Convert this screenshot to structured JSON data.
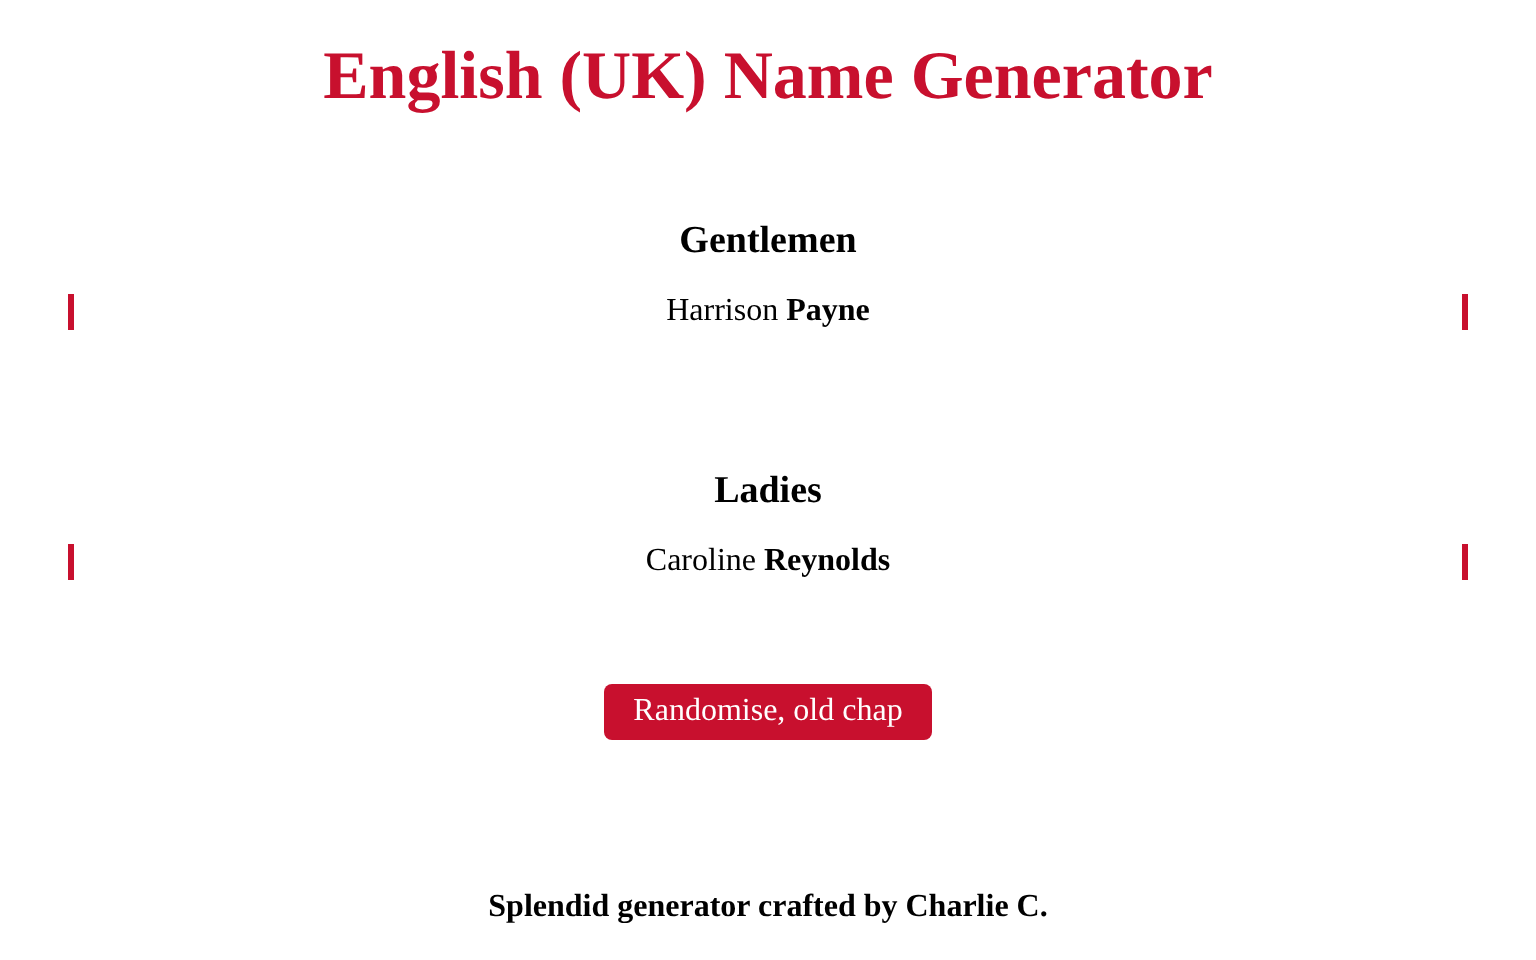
{
  "title": "English (UK) Name Generator",
  "sections": [
    {
      "heading": "Gentlemen",
      "name": "Harrison **Payne**"
    },
    {
      "heading": "Ladies",
      "name": "Caroline **Reynolds**"
    }
  ],
  "button": "Randomise, old chap",
  "footer": "Splendid generator crafted by Charlie C."
}
